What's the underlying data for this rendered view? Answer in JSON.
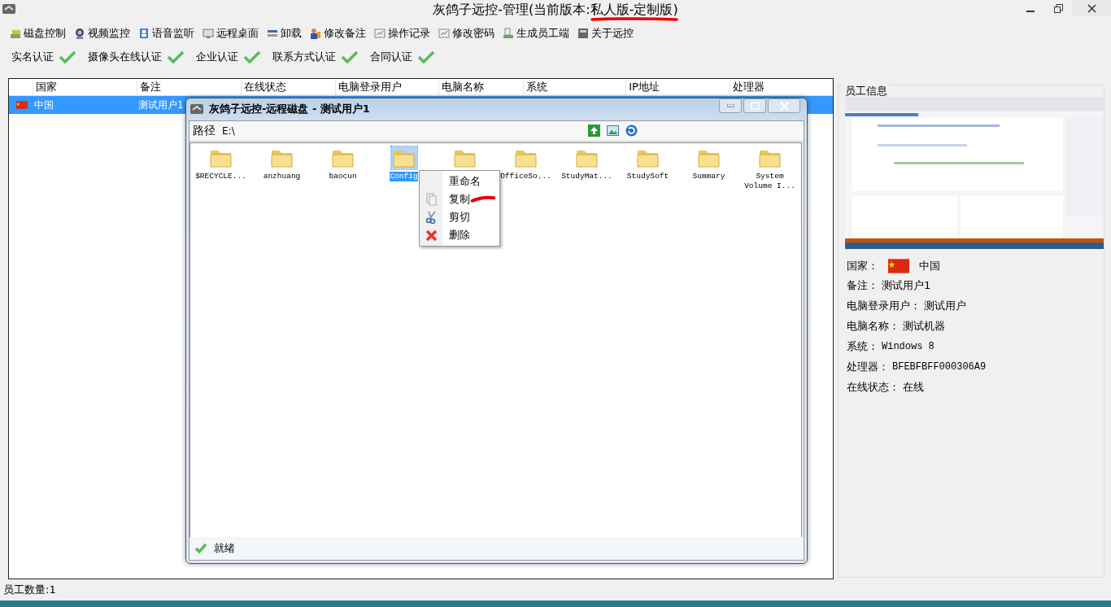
{
  "window": {
    "title": "灰鸽子远控-管理(当前版本:私人版-定制版)"
  },
  "toolbar": [
    {
      "label": "磁盘控制"
    },
    {
      "label": "视频监控"
    },
    {
      "label": "语音监听"
    },
    {
      "label": "远程桌面"
    },
    {
      "label": "卸载"
    },
    {
      "label": "修改备注"
    },
    {
      "label": "操作记录"
    },
    {
      "label": "修改密码"
    },
    {
      "label": "生成员工端"
    },
    {
      "label": "关于远控"
    }
  ],
  "certifications": [
    {
      "label": "实名认证",
      "checked": true
    },
    {
      "label": "摄像头在线认证",
      "checked": true
    },
    {
      "label": "企业认证",
      "checked": true
    },
    {
      "label": "联系方式认证",
      "checked": true
    },
    {
      "label": "合同认证",
      "checked": true
    }
  ],
  "table": {
    "columns": [
      "国家",
      "备注",
      "在线状态",
      "电脑登录用户",
      "电脑名称",
      "系统",
      "IP地址",
      "处理器"
    ],
    "rows": [
      {
        "selected": true,
        "cells": [
          "中国",
          "测试用户1"
        ]
      }
    ]
  },
  "dialog": {
    "title": "灰鸽子远控-远程磁盘 - 测试用户1",
    "path_label": "路径",
    "path": "E:\\",
    "files": [
      {
        "name": "$RECYCLE...",
        "selected": false
      },
      {
        "name": "anzhuang",
        "selected": false
      },
      {
        "name": "baocun",
        "selected": false
      },
      {
        "name": "Config",
        "selected": true
      },
      {
        "selected": false
      },
      {
        "name": "OfficeSo...",
        "selected": false
      },
      {
        "name": "StudyMat...",
        "selected": false
      },
      {
        "name": "StudySoft",
        "selected": false
      },
      {
        "name": "Summary",
        "selected": false
      },
      {
        "name": "System Volume I...",
        "selected": false
      }
    ],
    "status": "就绪"
  },
  "context_menu": [
    {
      "label": "重命名"
    },
    {
      "label": "复制"
    },
    {
      "label": "剪切"
    },
    {
      "label": "删除"
    }
  ],
  "employee_info": {
    "title": "员工信息",
    "fields": [
      {
        "kind": "flag",
        "label": "国家：",
        "value": "中国"
      },
      {
        "kind": "text",
        "label": "备注：",
        "value": "测试用户1"
      },
      {
        "kind": "text",
        "label": "电脑登录用户：",
        "value": "测试用户"
      },
      {
        "kind": "text",
        "label": "电脑名称：",
        "value": "测试机器"
      },
      {
        "kind": "text",
        "label": "系统：",
        "value": "Windows 8"
      },
      {
        "kind": "text",
        "label": "处理器：",
        "value": "BFEBFBFF000306A9"
      },
      {
        "kind": "text",
        "label": "在线状态：",
        "value": "在线"
      }
    ]
  },
  "status_bar": "员工数量:1"
}
